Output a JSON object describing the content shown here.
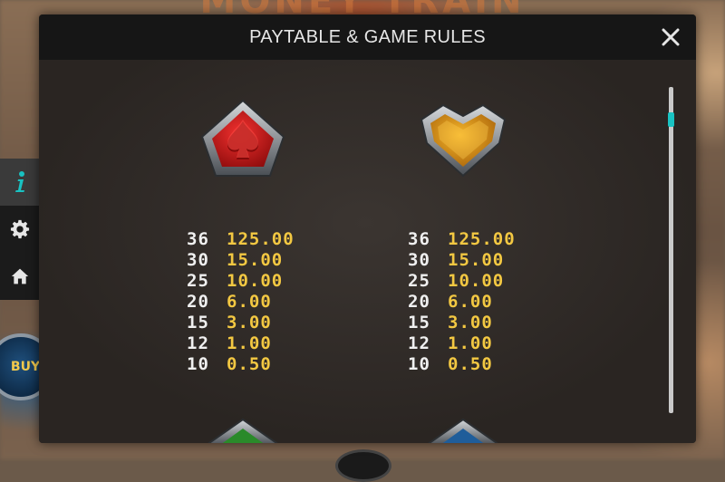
{
  "background": {
    "title_fragment": "MONEY TRAIN",
    "buy_badge": "BUY"
  },
  "side_menu": {
    "items": [
      {
        "name": "info",
        "icon": "info-icon",
        "active": true
      },
      {
        "name": "settings",
        "icon": "gear-icon",
        "active": false
      },
      {
        "name": "home",
        "icon": "home-icon",
        "active": false
      }
    ]
  },
  "modal": {
    "title": "PAYTABLE & GAME RULES",
    "close_icon": "close-icon",
    "colors": {
      "header_bg": "#161616",
      "body_bg": "#2a2522",
      "count_text": "#f0f0f0",
      "payout_text": "#f3c842",
      "scroll_thumb": "#19c2c2"
    }
  },
  "symbols": [
    {
      "name": "spade",
      "icon": "red-spade-symbol",
      "color": "#c4121a",
      "pays": [
        {
          "count": "36",
          "amount": "125.00"
        },
        {
          "count": "30",
          "amount": "15.00"
        },
        {
          "count": "25",
          "amount": "10.00"
        },
        {
          "count": "20",
          "amount": "6.00"
        },
        {
          "count": "15",
          "amount": "3.00"
        },
        {
          "count": "12",
          "amount": "1.00"
        },
        {
          "count": "10",
          "amount": "0.50"
        }
      ]
    },
    {
      "name": "heart",
      "icon": "orange-heart-symbol",
      "color": "#e09a12",
      "pays": [
        {
          "count": "36",
          "amount": "125.00"
        },
        {
          "count": "30",
          "amount": "15.00"
        },
        {
          "count": "25",
          "amount": "10.00"
        },
        {
          "count": "20",
          "amount": "6.00"
        },
        {
          "count": "15",
          "amount": "3.00"
        },
        {
          "count": "12",
          "amount": "1.00"
        },
        {
          "count": "10",
          "amount": "0.50"
        }
      ]
    }
  ],
  "next_symbols": [
    {
      "icon": "green-club-symbol",
      "color": "#2a8a2a"
    },
    {
      "icon": "blue-diamond-symbol",
      "color": "#1f5d9a"
    }
  ]
}
